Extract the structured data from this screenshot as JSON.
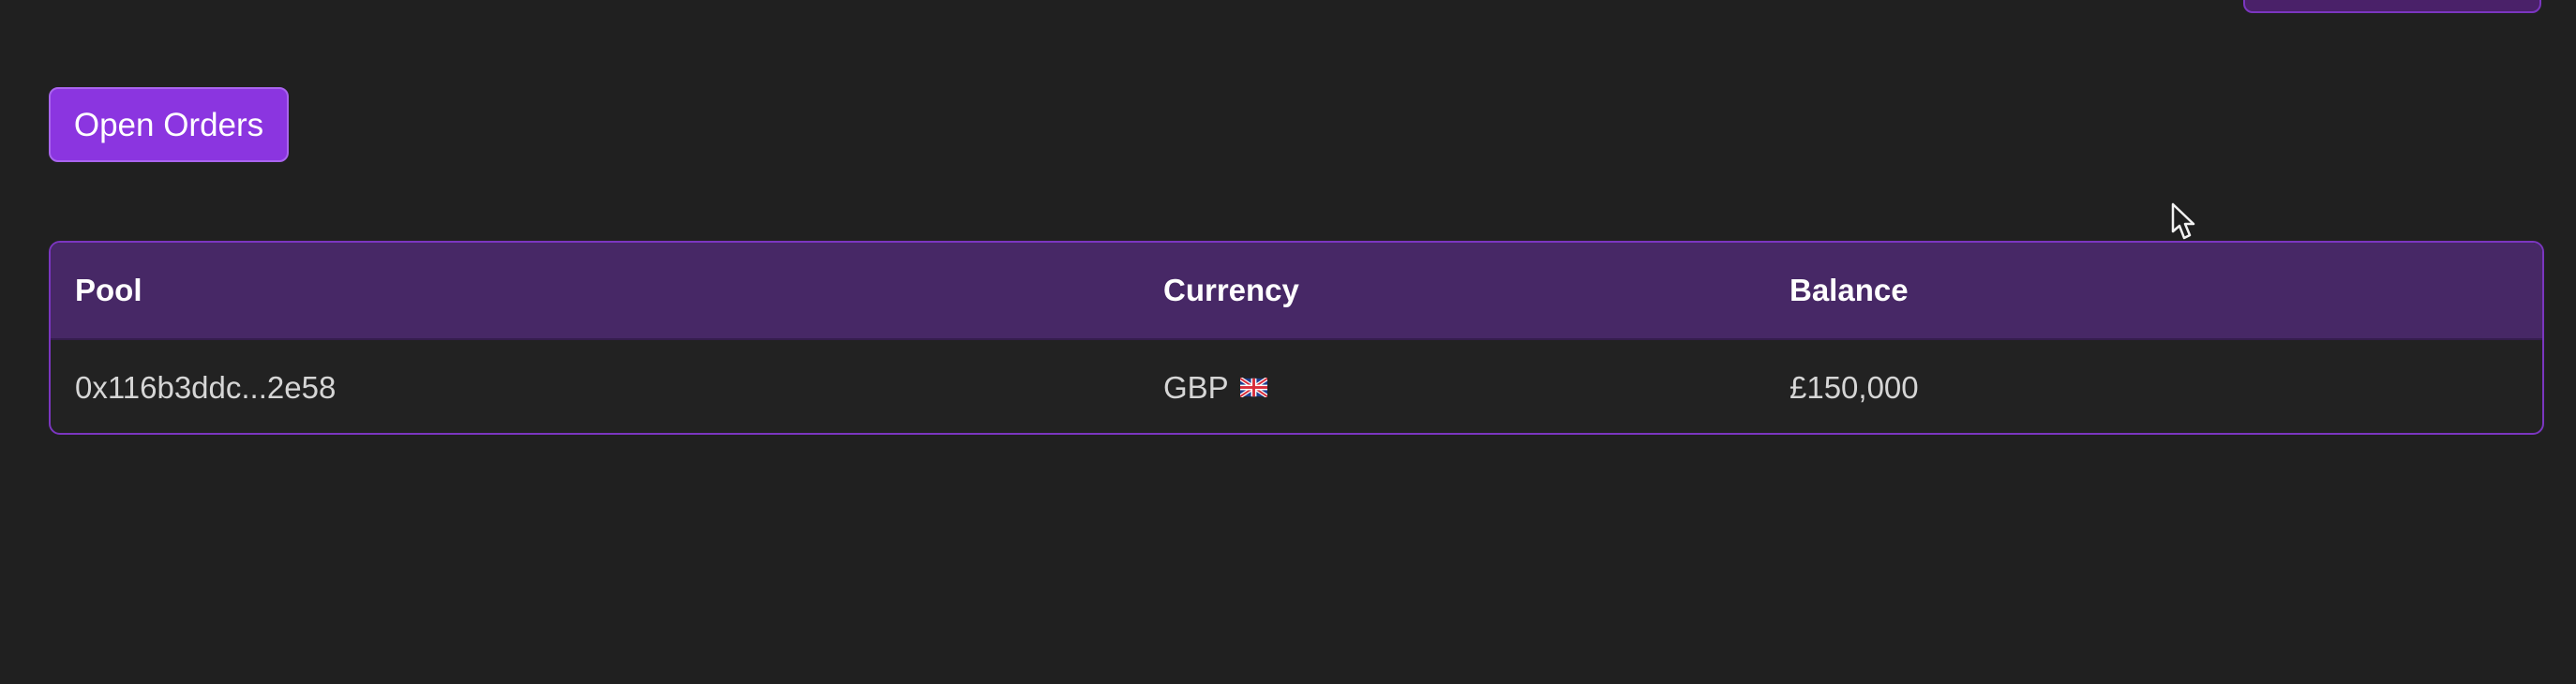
{
  "buttons": {
    "open_orders_label": "Open Orders"
  },
  "table": {
    "columns": [
      "Pool",
      "Currency",
      "Balance"
    ],
    "rows": [
      {
        "pool": "0x116b3ddc...2e58",
        "currency": "GBP",
        "currency_flag_icon": "uk-flag-icon",
        "balance": "£150,000"
      }
    ]
  },
  "colors": {
    "background": "#202020",
    "accent": "#8b35e0",
    "table_header": "#472866",
    "table_border": "#7b36c0"
  }
}
